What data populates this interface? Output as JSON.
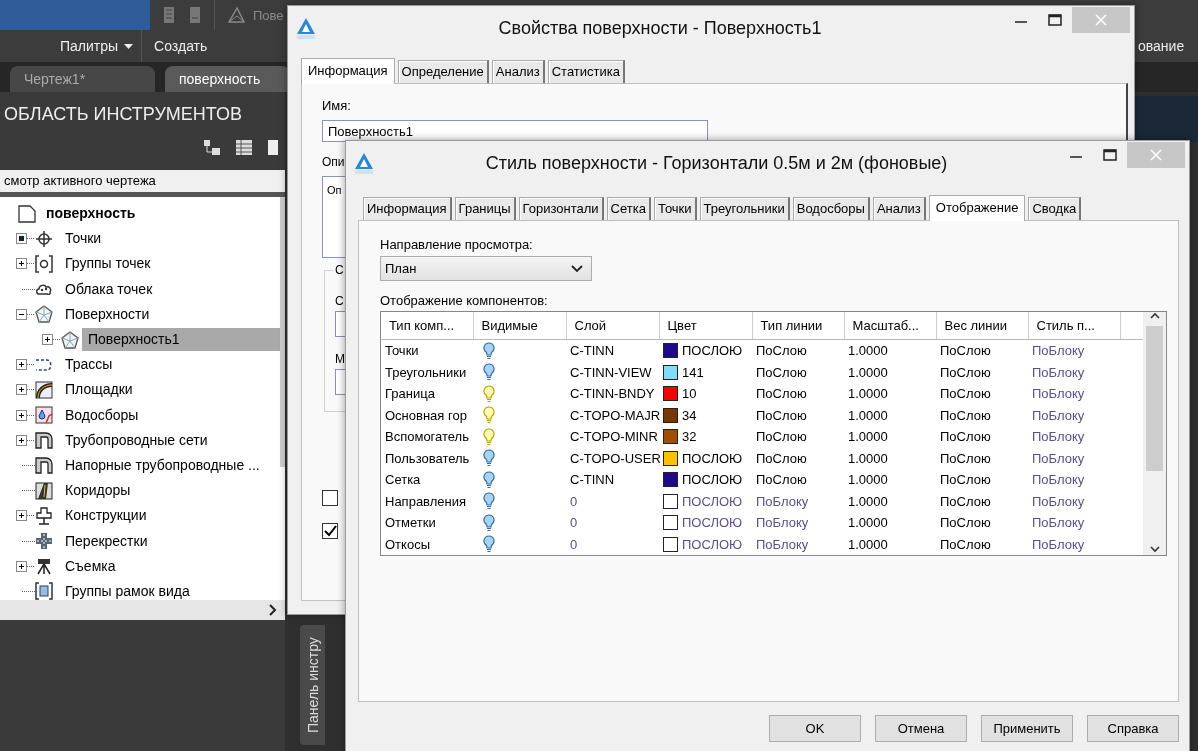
{
  "app": {
    "ribbon": {
      "top_label": "Пове",
      "panels": [
        {
          "label": "Палитры",
          "dropdown": true
        },
        {
          "label": "Создать",
          "dropdown": false
        }
      ],
      "right_label": "ование"
    },
    "file_tabs": [
      {
        "label": "Чертеж1*",
        "selected": false
      },
      {
        "label": "поверхность",
        "selected": true
      }
    ],
    "toolspace": {
      "title": "ОБЛАСТЬ ИНСТРУМЕНТОВ",
      "view_label": "смотр активного чертежа",
      "tree": {
        "label": "поверхность",
        "children": [
          {
            "label": "Точки",
            "kind": "marked",
            "selected": false
          },
          {
            "label": "Группы точек",
            "kind": "branch",
            "expanded": false,
            "selected": false
          },
          {
            "label": "Облака точек",
            "kind": "leaf",
            "selected": false
          },
          {
            "label": "Поверхности",
            "kind": "branch",
            "expanded": true,
            "selected": false,
            "children": [
              {
                "label": "Поверхность1",
                "kind": "branch",
                "expanded": false,
                "selected": true
              }
            ]
          },
          {
            "label": "Трассы",
            "kind": "branch",
            "expanded": false,
            "selected": false
          },
          {
            "label": "Площадки",
            "kind": "branch",
            "expanded": false,
            "selected": false
          },
          {
            "label": "Водосборы",
            "kind": "branch",
            "expanded": false,
            "selected": false
          },
          {
            "label": "Трубопроводные сети",
            "kind": "branch",
            "expanded": false,
            "selected": false
          },
          {
            "label": "Напорные трубопроводные ...",
            "kind": "leaf",
            "selected": false
          },
          {
            "label": "Коридоры",
            "kind": "leaf",
            "selected": false
          },
          {
            "label": "Конструкции",
            "kind": "branch",
            "expanded": false,
            "selected": false
          },
          {
            "label": "Перекрестки",
            "kind": "leaf",
            "selected": false
          },
          {
            "label": "Съемка",
            "kind": "branch",
            "expanded": false,
            "selected": false
          },
          {
            "label": "Группы рамок вида",
            "kind": "leaf",
            "selected": false
          }
        ]
      }
    },
    "side_tab": "Панель инстру"
  },
  "properties_dialog": {
    "title": "Свойства поверхности - Поверхность1",
    "tabs": [
      {
        "label": "Информация",
        "selected": true
      },
      {
        "label": "Определение",
        "selected": false
      },
      {
        "label": "Анализ",
        "selected": false
      },
      {
        "label": "Статистика",
        "selected": false
      }
    ],
    "name_label": "Имя:",
    "name_value": "Поверхность1",
    "description_label": "Опи",
    "description_value": "Оп",
    "group_label": "С",
    "fields": [
      {
        "label": "С"
      },
      {
        "label": "М"
      }
    ],
    "checkboxes": [
      {
        "checked": false
      },
      {
        "checked": true
      }
    ]
  },
  "style_dialog": {
    "title": "Стиль поверхности - Горизонтали 0.5м и 2м (фоновые)",
    "tabs": [
      {
        "label": "Информация",
        "selected": false
      },
      {
        "label": "Границы",
        "selected": false
      },
      {
        "label": "Горизонтали",
        "selected": false
      },
      {
        "label": "Сетка",
        "selected": false
      },
      {
        "label": "Точки",
        "selected": false
      },
      {
        "label": "Треугольники",
        "selected": false
      },
      {
        "label": "Водосборы",
        "selected": false
      },
      {
        "label": "Анализ",
        "selected": false
      },
      {
        "label": "Отображение",
        "selected": true
      },
      {
        "label": "Сводка",
        "selected": false
      }
    ],
    "view_direction_label": "Направление просмотра:",
    "view_direction_value": "План",
    "components_label": "Отображение компонентов:",
    "columns": [
      "Тип комп...",
      "Видимые",
      "Слой",
      "Цвет",
      "Тип линии",
      "Масштаб...",
      "Вес линии",
      "Стиль п..."
    ],
    "rows": [
      {
        "type": "Точки",
        "visible": false,
        "layer": "C-TINN",
        "color": "#1c0a8a",
        "color_name": "ПОСЛОЮ",
        "linetype": "ПоСлою",
        "scale": "1.0000",
        "lineweight": "ПоСлою",
        "plot_style": "ПоБлоку",
        "muted": false
      },
      {
        "type": "Треугольники",
        "visible": false,
        "layer": "C-TINN-VIEW",
        "color": "#80dcf8",
        "color_name": "141",
        "linetype": "ПоСлою",
        "scale": "1.0000",
        "lineweight": "ПоСлою",
        "plot_style": "ПоБлоку",
        "muted": false
      },
      {
        "type": "Граница",
        "visible": true,
        "layer": "C-TINN-BNDY",
        "color": "#ff0000",
        "color_name": "10",
        "linetype": "ПоСлою",
        "scale": "1.0000",
        "lineweight": "ПоСлою",
        "plot_style": "ПоБлоку",
        "muted": false
      },
      {
        "type": "Основная гор",
        "visible": true,
        "layer": "C-TOPO-MAJR",
        "color": "#7a3800",
        "color_name": "34",
        "linetype": "ПоСлою",
        "scale": "1.0000",
        "lineweight": "ПоСлою",
        "plot_style": "ПоБлоку",
        "muted": false
      },
      {
        "type": "Вспомогатель",
        "visible": true,
        "layer": "C-TOPO-MINR",
        "color": "#a44c00",
        "color_name": "32",
        "linetype": "ПоСлою",
        "scale": "1.0000",
        "lineweight": "ПоСлою",
        "plot_style": "ПоБлоку",
        "muted": false
      },
      {
        "type": "Пользователь",
        "visible": false,
        "layer": "C-TOPO-USER",
        "color": "#ffc000",
        "color_name": "ПОСЛОЮ",
        "linetype": "ПоСлою",
        "scale": "1.0000",
        "lineweight": "ПоСлою",
        "plot_style": "ПоБлоку",
        "muted": false
      },
      {
        "type": "Сетка",
        "visible": false,
        "layer": "C-TINN",
        "color": "#1c0a8a",
        "color_name": "ПОСЛОЮ",
        "linetype": "ПоСлою",
        "scale": "1.0000",
        "lineweight": "ПоСлою",
        "plot_style": "ПоБлоку",
        "muted": false
      },
      {
        "type": "Направления",
        "visible": false,
        "layer": "0",
        "color": "#ffffff",
        "color_name": "ПОСЛОЮ",
        "linetype": "ПоБлоку",
        "scale": "1.0000",
        "lineweight": "ПоСлою",
        "plot_style": "ПоБлоку",
        "muted": true
      },
      {
        "type": "Отметки",
        "visible": false,
        "layer": "0",
        "color": "#ffffff",
        "color_name": "ПОСЛОЮ",
        "linetype": "ПоБлоку",
        "scale": "1.0000",
        "lineweight": "ПоСлою",
        "plot_style": "ПоБлоку",
        "muted": true
      },
      {
        "type": "Откосы",
        "visible": false,
        "layer": "0",
        "color": "#ffffff",
        "color_name": "ПОСЛОЮ",
        "linetype": "ПоБлоку",
        "scale": "1.0000",
        "lineweight": "ПоСлою",
        "plot_style": "ПоБлоку",
        "muted": true
      }
    ],
    "buttons": [
      "OK",
      "Отмена",
      "Применить",
      "Справка"
    ]
  }
}
